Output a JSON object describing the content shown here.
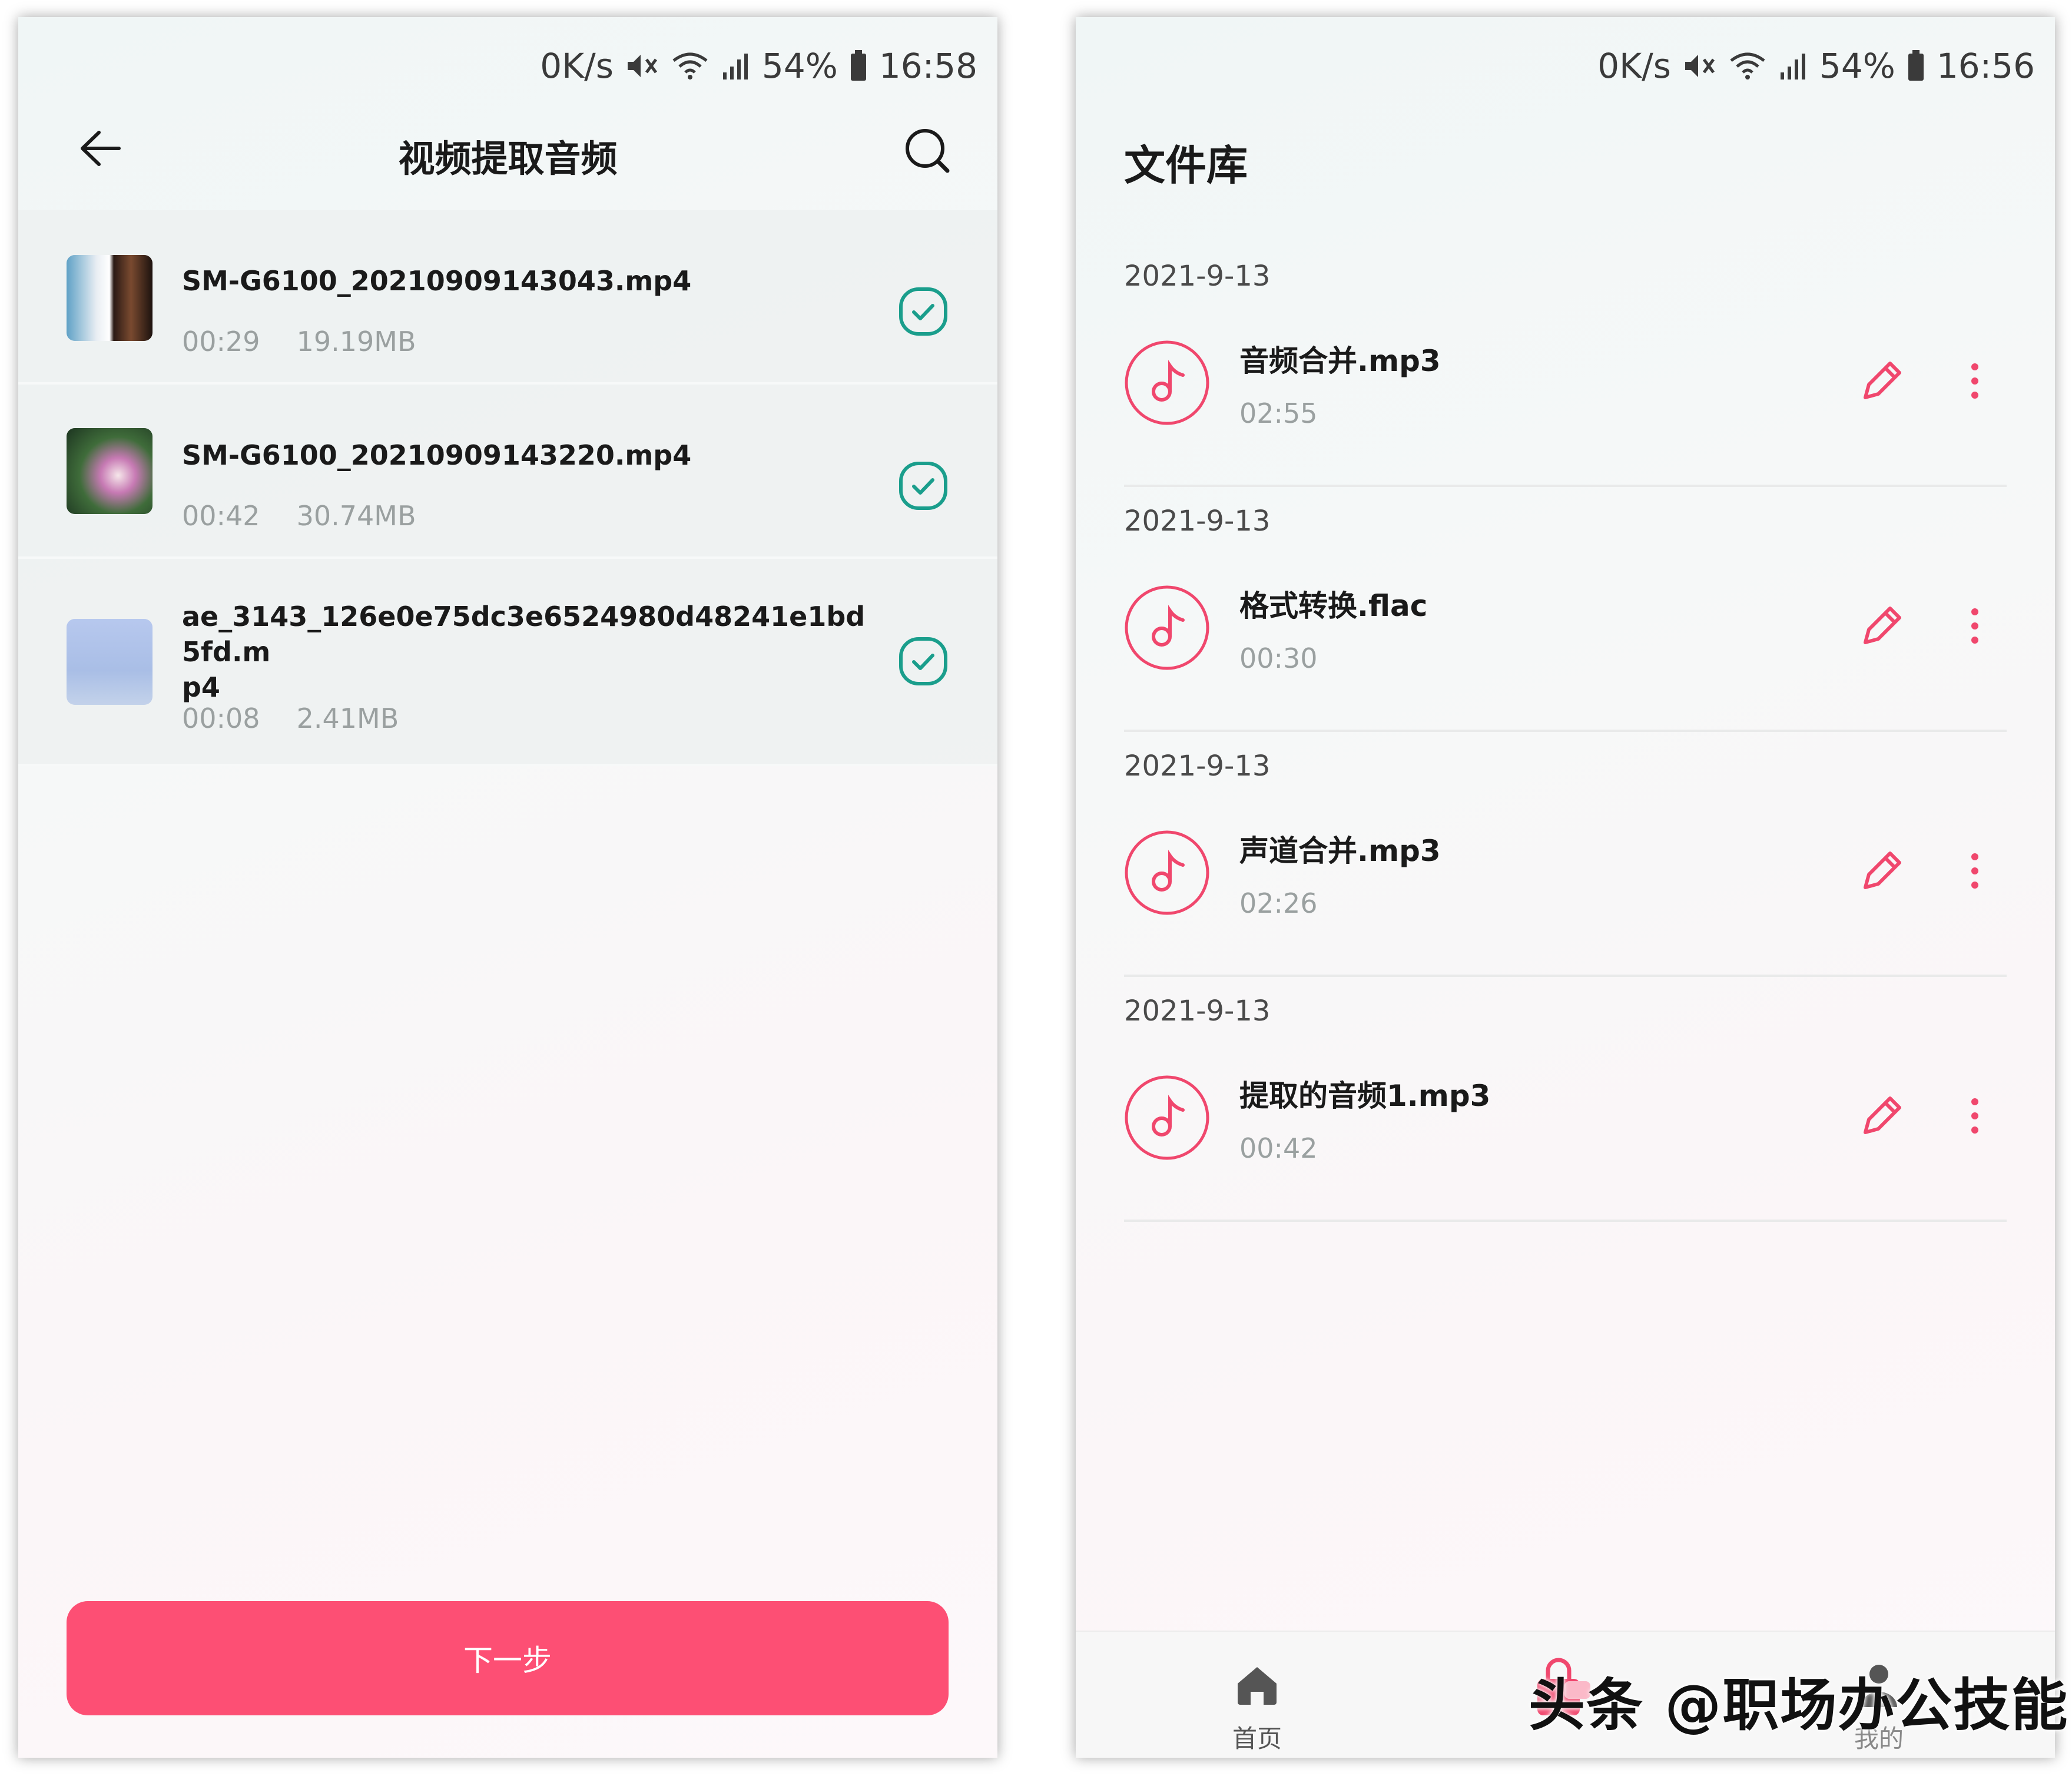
{
  "left_screen": {
    "status": {
      "speed": "0K/s",
      "battery": "54%",
      "time": "16:58"
    },
    "title": "视频提取音频",
    "videos": [
      {
        "name": "SM-G6100_20210909143043.mp4",
        "duration": "00:29",
        "size": "19.19MB"
      },
      {
        "name": "SM-G6100_20210909143220.mp4",
        "duration": "00:42",
        "size": "30.74MB"
      },
      {
        "name": "ae_3143_126e0e75dc3e6524980d48241e1bd5fd.m\np4",
        "duration": "00:08",
        "size": "2.41MB"
      }
    ],
    "next_label": "下一步"
  },
  "right_screen": {
    "status": {
      "speed": "0K/s",
      "battery": "54%",
      "time": "16:56"
    },
    "title": "文件库",
    "files": [
      {
        "date": "2021-9-13",
        "name": "音频合并.mp3",
        "duration": "02:55"
      },
      {
        "date": "2021-9-13",
        "name": "格式转换.flac",
        "duration": "00:30"
      },
      {
        "date": "2021-9-13",
        "name": "声道合并.mp3",
        "duration": "02:26"
      },
      {
        "date": "2021-9-13",
        "name": "提取的音频1.mp3",
        "duration": "00:42"
      }
    ],
    "nav": {
      "home": "首页",
      "me": "我的"
    }
  },
  "watermark": "头条 @职场办公技能",
  "colors": {
    "accent": "#fd4f74",
    "check": "#1a9e8c",
    "pink_icon": "#f0476d"
  },
  "icons": [
    "back-arrow-icon",
    "search-icon",
    "check-icon",
    "music-note-icon",
    "edit-pencil-icon",
    "more-vertical-icon",
    "home-icon",
    "bag-icon",
    "person-icon",
    "mute-icon",
    "wifi-icon",
    "signal-icon",
    "battery-icon"
  ]
}
